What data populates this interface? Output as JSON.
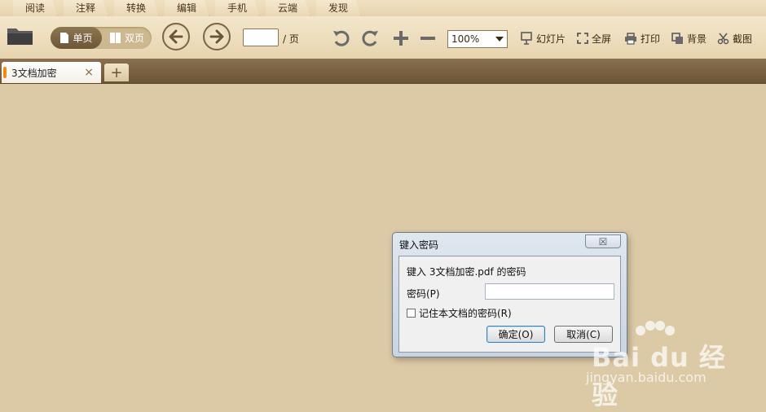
{
  "menu": {
    "tabs": [
      {
        "label": "阅读"
      },
      {
        "label": "注释"
      },
      {
        "label": "转换"
      },
      {
        "label": "编辑"
      },
      {
        "label": "手机"
      },
      {
        "label": "云端"
      },
      {
        "label": "发现"
      }
    ]
  },
  "toolbar": {
    "view_single": "单页",
    "view_double": "双页",
    "page_value": "",
    "page_suffix": "/ 页",
    "zoom": "100%",
    "slideshow": "幻灯片",
    "fullscreen": "全屏",
    "print": "打印",
    "background": "背景",
    "screenshot": "截图"
  },
  "tabs": {
    "doc_title": "3文档加密",
    "close_glyph": "×",
    "add_glyph": "+"
  },
  "dialog": {
    "title": "键入密码",
    "close_glyph": "☒",
    "prompt": "键入 3文档加密.pdf 的密码",
    "password_label": "密码(P)",
    "password_value": "",
    "remember_label": "记住本文档的密码(R)",
    "remember_checked": false,
    "ok_label": "确定(O)",
    "cancel_label": "取消(C)"
  },
  "watermark": {
    "brand": "Bai du 经验",
    "url": "jingyan.baidu.com"
  },
  "colors": {
    "toolbar_bg": "#ecdcbb",
    "tabstrip_bg": "#7a6040",
    "canvas_bg": "#dccaa7",
    "doc_indicator": "#ef8a12"
  }
}
